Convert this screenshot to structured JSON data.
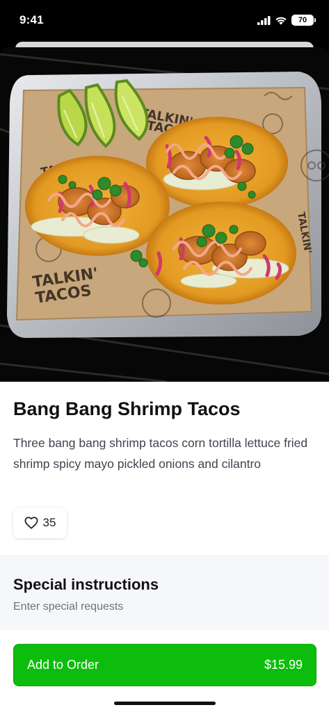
{
  "status_bar": {
    "time": "9:41",
    "battery": "70",
    "icons": [
      "signal-icon",
      "wifi-icon",
      "battery-icon"
    ]
  },
  "item": {
    "title": "Bang Bang Shrimp Tacos",
    "description": "Three bang bang shrimp tacos corn tortilla lettuce fried shrimp spicy mayo pickled onions and cilantro",
    "likes": "35",
    "image_alt": "photo-of-tacos",
    "tray_print": "TALKIN' TACOS"
  },
  "special_instructions": {
    "title": "Special instructions",
    "placeholder": "Enter special requests"
  },
  "cart": {
    "button_label": "Add to Order",
    "price": "$15.99"
  },
  "colors": {
    "accent_green": "#0dbd0d",
    "section_bg": "#f5f7fa"
  }
}
